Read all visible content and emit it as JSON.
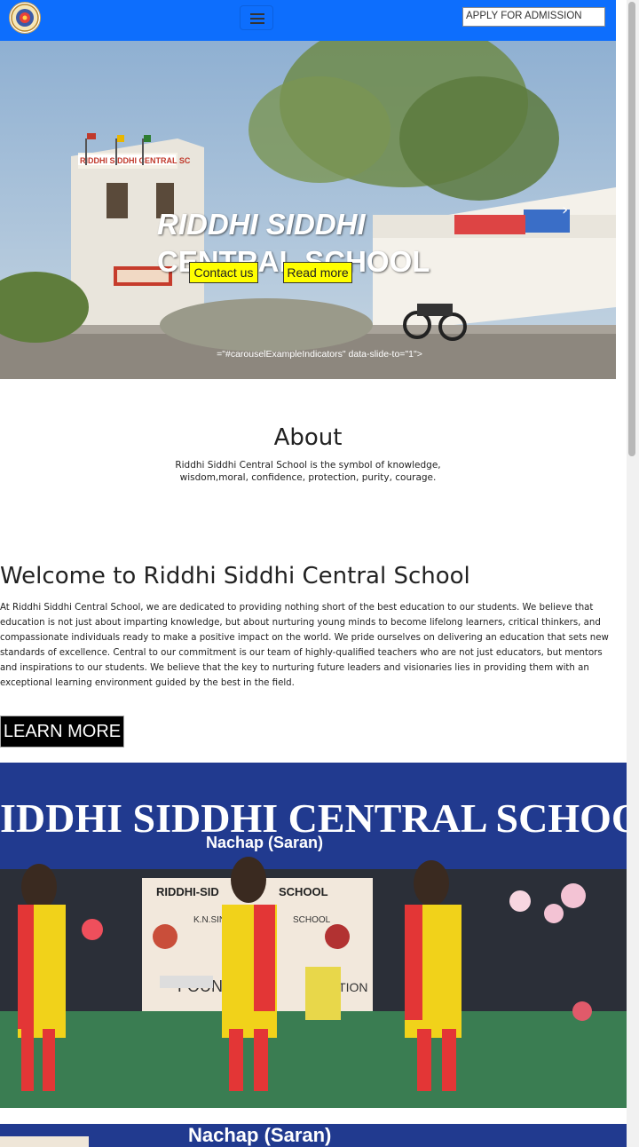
{
  "navbar": {
    "logo": "school-logo",
    "toggler_icon": "hamburger-menu-icon",
    "admission_field": "APPLY FOR ADMISSION"
  },
  "hero": {
    "title_line1": "RIDDHI SIDDHI",
    "title_line2": "CENTRAL SCHOOL",
    "contact_label": "Contact us",
    "readmore_label": "Read more",
    "next_label": "Next",
    "stray_text": "=\"#carouselExampleIndicators\" data-slide-to=\"1\">"
  },
  "photo_sign": {
    "banner": "IDDHI SIDDHI CENTRAL SCHOOL",
    "banner_sub": "Nachap (Saran)",
    "board_title": "RIDDHI-SID",
    "board_title2": "SCHOOL",
    "board_line": "K.N.SINGH",
    "board_line2": "SCHOOL",
    "board_found": "FOUND",
    "board_ebration": "EBRATION",
    "strip_text": "Nachap (Saran)"
  },
  "about": {
    "title": "About",
    "text": "Riddhi Siddhi Central School is the symbol of knowledge, wisdom,moral, confidence, protection, purity, courage."
  },
  "welcome": {
    "title": "Welcome to Riddhi Siddhi Central School",
    "paragraph": "At Riddhi Siddhi Central School, we are dedicated to providing nothing short of the best education to our students. We believe that education is not just about imparting knowledge, but about nurturing young minds to become lifelong learners, critical thinkers, and compassionate individuals ready to make a positive impact on the world. We pride ourselves on delivering an education that sets new standards of excellence. Central to our commitment is our team of highly-qualified teachers who are not just educators, but mentors and inspirations to our students. We believe that the key to nurturing future leaders and visionaries lies in providing them with an exceptional learning environment guided by the best in the field.",
    "button": "LEARN MORE"
  },
  "colors": {
    "navbar": "#0d6efd",
    "hero_button": "#ffff00",
    "learn_button": "#000000"
  }
}
